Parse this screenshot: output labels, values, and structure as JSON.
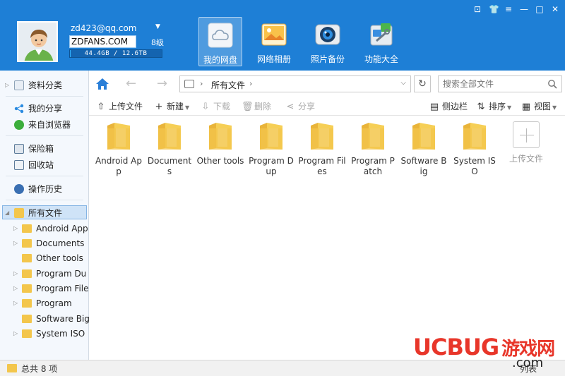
{
  "header": {
    "email": "zd423@qq.com",
    "display_name": "ZDFANS.COM",
    "level": "8级",
    "quota_text": "44.4GB / 12.6TB",
    "quota_fraction": 0.004,
    "window_controls": [
      "⊡",
      "👕",
      "≡",
      "—",
      "□",
      "✕"
    ],
    "tabs": [
      {
        "label": "我的网盘",
        "icon": "cloud-icon",
        "active": true
      },
      {
        "label": "网络相册",
        "icon": "photo-album-icon",
        "active": false
      },
      {
        "label": "照片备份",
        "icon": "camera-icon",
        "active": false
      },
      {
        "label": "功能大全",
        "icon": "toolbox-icon",
        "active": false
      }
    ]
  },
  "sidebar": {
    "nav": [
      {
        "label": "资料分类",
        "icon": "document-icon"
      },
      {
        "label": "我的分享",
        "icon": "share-icon"
      },
      {
        "label": "来自浏览器",
        "icon": "browser-icon"
      },
      {
        "label": "保险箱",
        "icon": "safe-icon"
      },
      {
        "label": "回收站",
        "icon": "trash-icon"
      },
      {
        "label": "操作历史",
        "icon": "history-icon"
      },
      {
        "label": "所有文件",
        "icon": "all-files-icon"
      }
    ],
    "folders": [
      "Android App",
      "Documents",
      "Other tools",
      "Program Du",
      "Program File",
      "Program",
      "Software Big",
      "System ISO"
    ]
  },
  "address_bar": {
    "current_folder": "所有文件",
    "search_placeholder": "搜索全部文件"
  },
  "actions": {
    "upload": "上传文件",
    "new": "新建",
    "download": "下载",
    "delete": "删除",
    "share": "分享",
    "sidebar": "侧边栏",
    "sort": "排序",
    "view": "视图"
  },
  "files": [
    {
      "name": "Android App"
    },
    {
      "name": "Documents"
    },
    {
      "name": "Other tools"
    },
    {
      "name": "Program Dup"
    },
    {
      "name": "Program Files"
    },
    {
      "name": "Program Patch"
    },
    {
      "name": "Software Big"
    },
    {
      "name": "System ISO"
    }
  ],
  "upload_tile": "上传文件",
  "status": {
    "total": "总共 8 项",
    "right": "列表"
  },
  "watermark": {
    "brand_a": "UC",
    "brand_b": "BUG",
    "brand_cn": "游戏网",
    "domain": ".com"
  },
  "colors": {
    "header_blue": "#1e7fd6",
    "folder_yellow": "#f3c64c",
    "selection": "#cfe3f7"
  }
}
